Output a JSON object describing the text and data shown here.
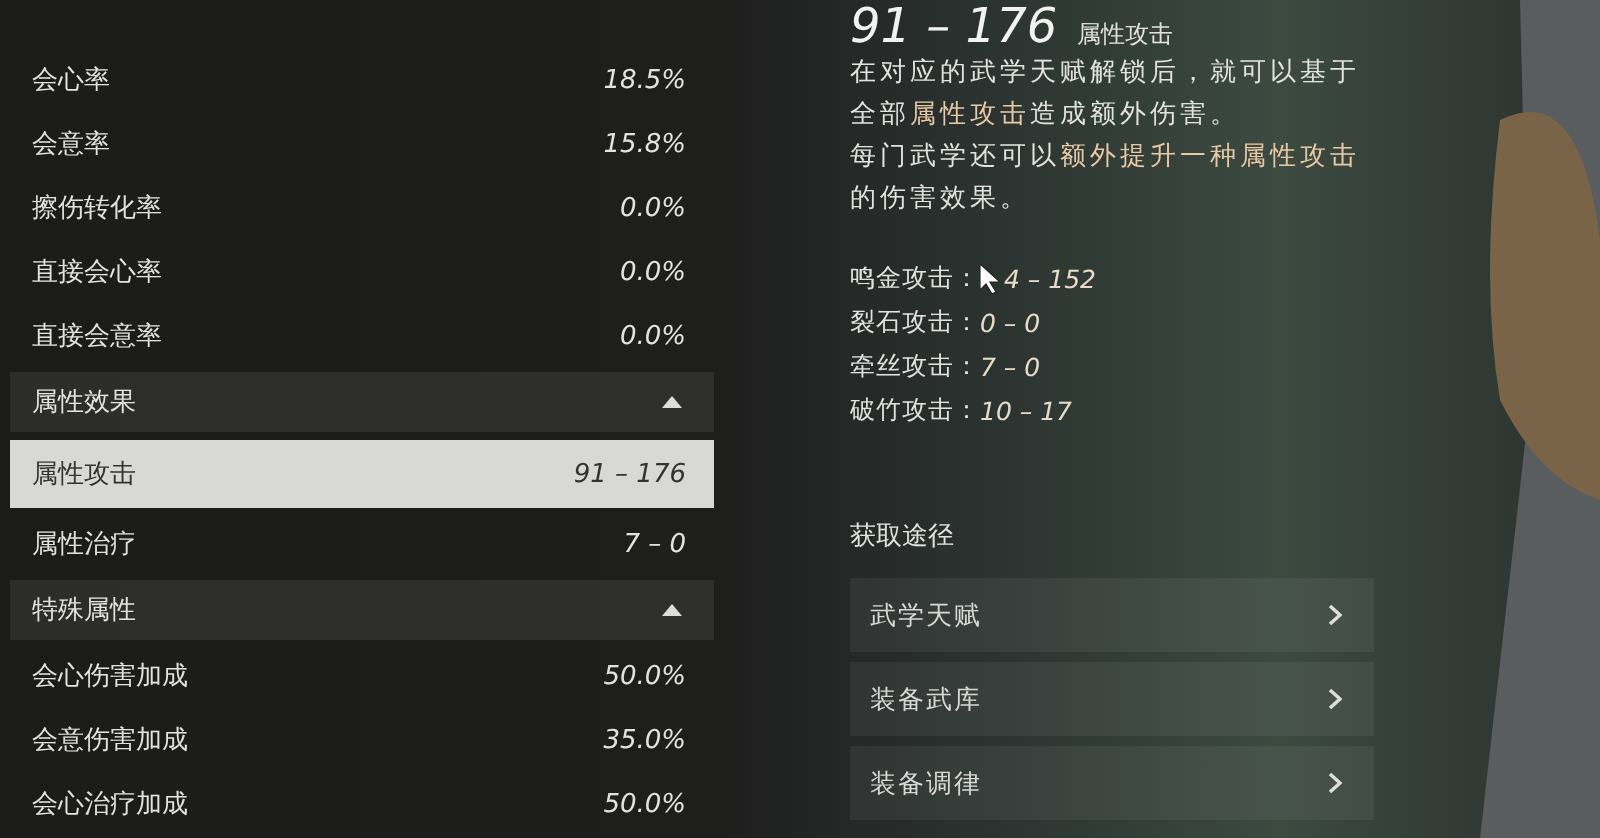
{
  "stats": [
    {
      "kind": "row",
      "label": "会心率",
      "value": "18.5%",
      "selected": false
    },
    {
      "kind": "row",
      "label": "会意率",
      "value": "15.8%",
      "selected": false
    },
    {
      "kind": "row",
      "label": "擦伤转化率",
      "value": "0.0%",
      "selected": false
    },
    {
      "kind": "row",
      "label": "直接会心率",
      "value": "0.0%",
      "selected": false
    },
    {
      "kind": "row",
      "label": "直接会意率",
      "value": "0.0%",
      "selected": false
    },
    {
      "kind": "header",
      "label": "属性效果",
      "expanded": true
    },
    {
      "kind": "row",
      "label": "属性攻击",
      "value": "91 – 176",
      "selected": true
    },
    {
      "kind": "row",
      "label": "属性治疗",
      "value": "7 – 0",
      "selected": false
    },
    {
      "kind": "header",
      "label": "特殊属性",
      "expanded": true
    },
    {
      "kind": "row",
      "label": "会心伤害加成",
      "value": "50.0%",
      "selected": false
    },
    {
      "kind": "row",
      "label": "会意伤害加成",
      "value": "35.0%",
      "selected": false
    },
    {
      "kind": "row",
      "label": "会心治疗加成",
      "value": "50.0%",
      "selected": false
    }
  ],
  "detail": {
    "value": "91 – 176",
    "label": "属性攻击",
    "description": [
      "在对应的武学天赋解锁后，就可以基于全部**属性攻击**造成额外伤害。",
      "每门武学还可以**额外提升一种属性攻击**的伤害效果。"
    ],
    "breakdown": [
      {
        "label": "鸣金攻击：",
        "value": "4 – 152",
        "cursor": true
      },
      {
        "label": "裂石攻击：",
        "value": "0 – 0",
        "cursor": false
      },
      {
        "label": "牵丝攻击：",
        "value": "7 – 0",
        "cursor": false
      },
      {
        "label": "破竹攻击：",
        "value": "10 – 17",
        "cursor": false
      }
    ]
  },
  "sources": {
    "title": "获取途径",
    "items": [
      "武学天赋",
      "装备武库",
      "装备调律"
    ]
  }
}
